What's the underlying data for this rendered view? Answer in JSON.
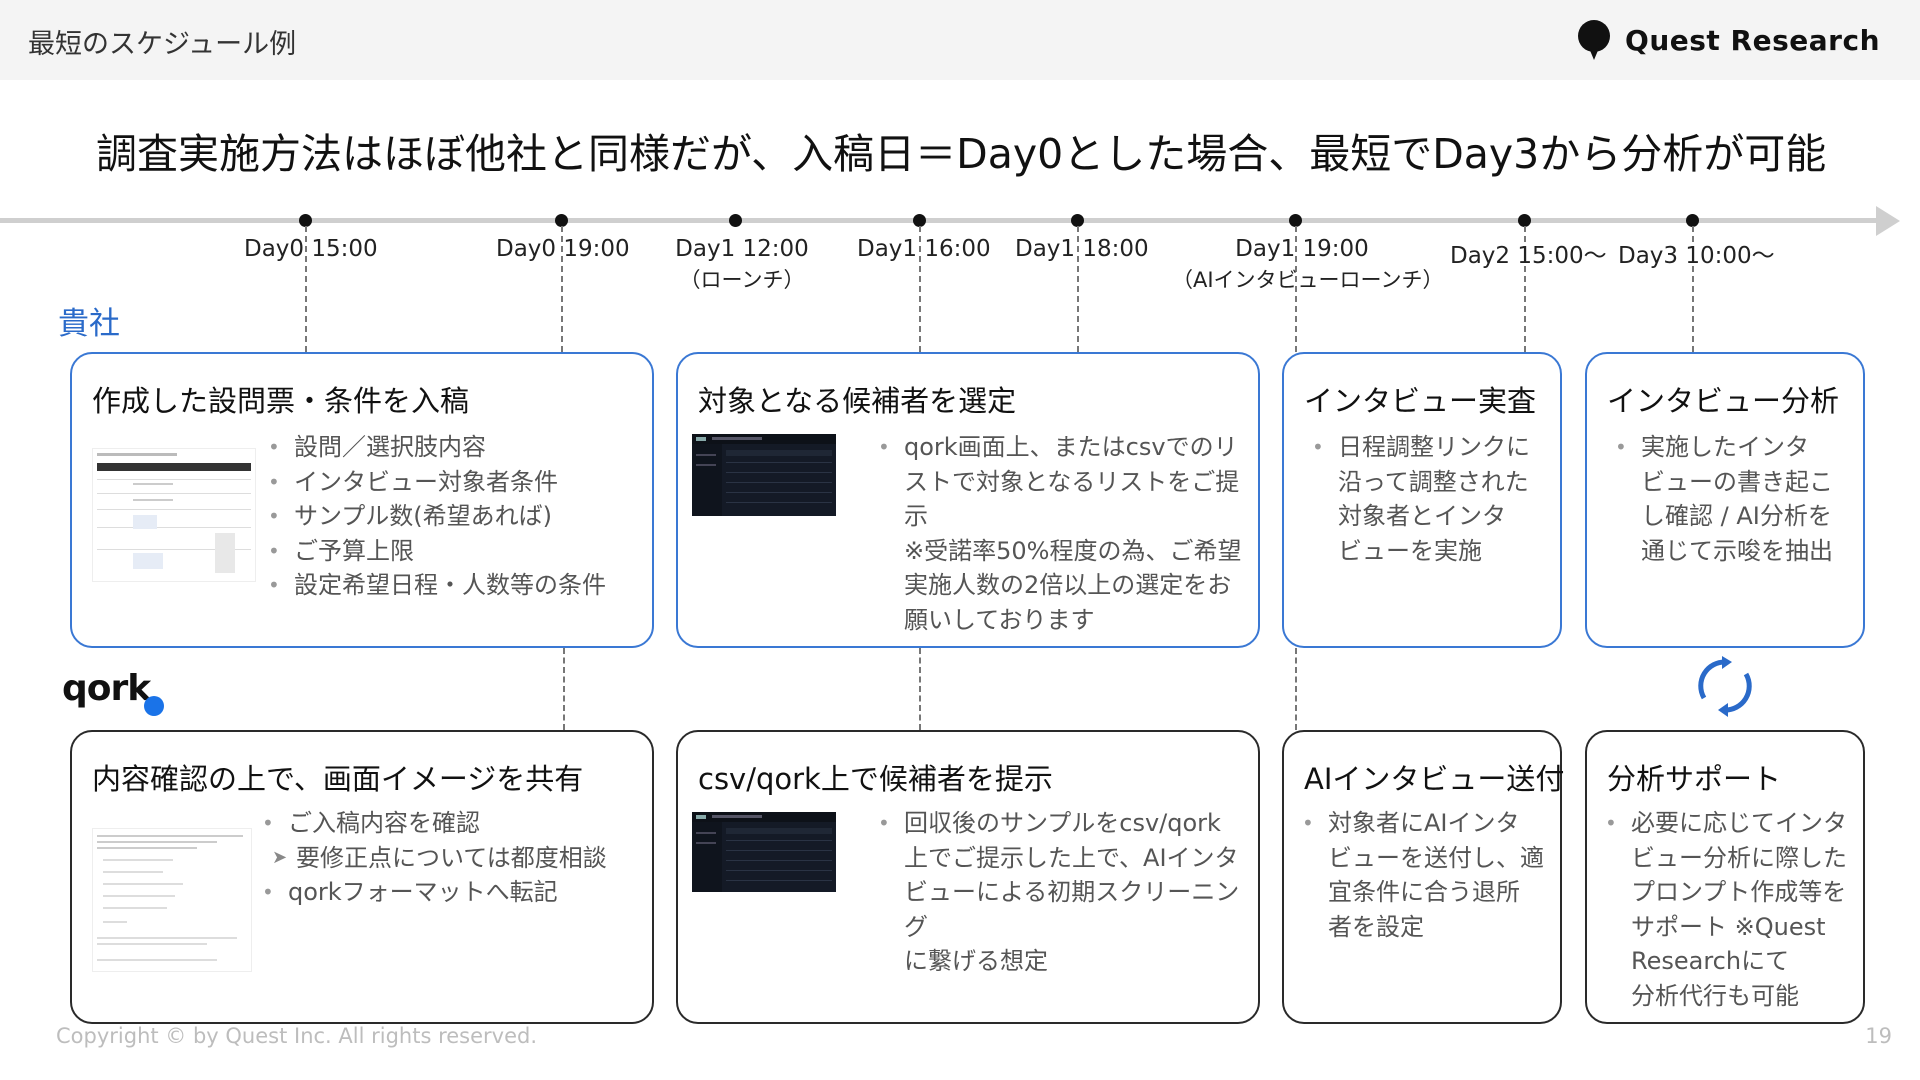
{
  "header": {
    "section_title": "最短のスケジュール例",
    "brand_name": "Quest Research"
  },
  "headline": "調査実施方法はほぼ他社と同様だが、入稿日＝Day0とした場合、最短でDay3から分析が可能",
  "timeline": {
    "points": [
      {
        "label": "Day0 15:00",
        "sub": ""
      },
      {
        "label": "Day0 19:00",
        "sub": ""
      },
      {
        "label": "Day1 12:00",
        "sub": "（ローンチ）"
      },
      {
        "label": "Day1 16:00",
        "sub": ""
      },
      {
        "label": "Day1 18:00",
        "sub": ""
      },
      {
        "label": "Day1 19:00",
        "sub": "（AIインタビューローンチ）"
      },
      {
        "label": "Day2 15:00～",
        "sub": ""
      },
      {
        "label": "Day3 10:00～",
        "sub": ""
      }
    ]
  },
  "rows": {
    "client_label": "貴社",
    "qork_label": "qork"
  },
  "client_cards": [
    {
      "title": "作成した設問票・条件を入稿",
      "bullets": [
        "設問／選択肢内容",
        "インタビュー対象者条件",
        "サンプル数(希望あれば)",
        "ご予算上限",
        "設定希望日程・人数等の条件"
      ]
    },
    {
      "title": "対象となる候補者を選定",
      "bullets": [
        "qork画面上、またはcsvでのリ",
        "ストで対象となるリストをご提示",
        "※受諾率50%程度の為、ご希望",
        "実施人数の2倍以上の選定をお",
        "願いしております"
      ]
    },
    {
      "title": "インタビュー実査",
      "bullets": [
        "日程調整リンクに",
        "沿って調整された",
        "対象者とインタ",
        "ビューを実施"
      ]
    },
    {
      "title": "インタビュー分析",
      "bullets": [
        "実施したインタ",
        "ビューの書き起こ",
        "し確認 / AI分析を",
        "通じて示唆を抽出"
      ]
    }
  ],
  "qork_cards": [
    {
      "title": "内容確認の上で、画面イメージを共有",
      "bullets": [
        "ご入稿内容を確認",
        "要修正点については都度相談",
        "qorkフォーマットへ転記"
      ]
    },
    {
      "title": "csv/qork上で候補者を提示",
      "bullets": [
        "回収後のサンプルをcsv/qork",
        "上でご提示した上で、AIインタ",
        "ビューによる初期スクリーニング",
        "に繋げる想定"
      ]
    },
    {
      "title": "AIインタビュー送付",
      "bullets": [
        "対象者にAIインタ",
        "ビューを送付し、適",
        "宜条件に合う退所",
        "者を設定"
      ]
    },
    {
      "title": "分析サポート",
      "bullets": [
        "必要に応じてインタ",
        "ビュー分析に際した",
        "プロンプト作成等を",
        "サポート ※Quest",
        "Researchにて",
        "分析代行も可能"
      ]
    }
  ],
  "footer": {
    "copyright": "Copyright © by Quest Inc. All rights reserved.",
    "page": "19"
  },
  "colors": {
    "accent_blue": "#3a78d4",
    "title_blue": "#2a6ac9",
    "dark_border": "#2a2a2a",
    "qork_dot": "#1a73e8"
  },
  "icons": [
    "speech-bubble-logo-icon",
    "cycle-arrows-icon"
  ]
}
